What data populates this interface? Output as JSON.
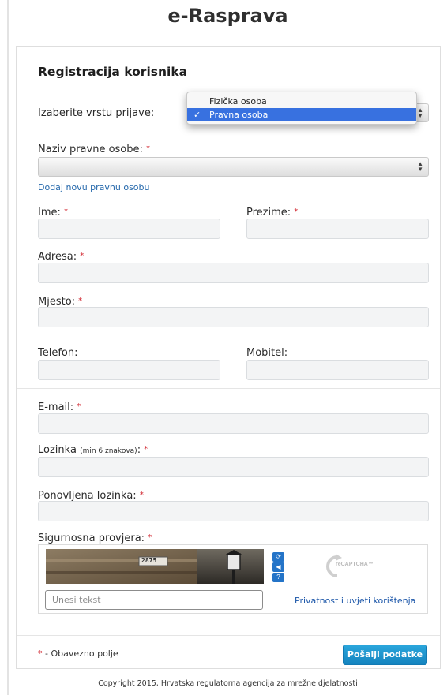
{
  "app": {
    "title": "e-Rasprava"
  },
  "form": {
    "section_title": "Registracija korisnika",
    "login_type": {
      "label": "Izaberite vrstu prijave:",
      "options": [
        "Fizička osoba",
        "Pravna osoba"
      ],
      "selected": "Pravna osoba",
      "check_mark": "✓"
    },
    "legal_entity": {
      "label": "Naziv pravne osobe:",
      "value": "",
      "add_link": "Dodaj novu pravnu osobu"
    },
    "first_name": {
      "label": "Ime:"
    },
    "last_name": {
      "label": "Prezime:"
    },
    "address": {
      "label": "Adresa:"
    },
    "city": {
      "label": "Mjesto:"
    },
    "phone": {
      "label": "Telefon:"
    },
    "mobile": {
      "label": "Mobitel:"
    },
    "email": {
      "label": "E-mail:"
    },
    "password": {
      "label": "Lozinka",
      "hint": "(min 6 znakova)",
      "colon": ":"
    },
    "password_repeat": {
      "label": "Ponovljena lozinka:"
    },
    "captcha": {
      "label": "Sigurnosna provjera:",
      "image_text": "2875",
      "placeholder": "Unesi tekst",
      "privacy_link": "Privatnost i uvjeti korištenja",
      "logo_text": "reCAPTCHA™"
    },
    "required_marker": "*",
    "required_note": " - Obavezno polje",
    "submit_label": "Pošalji podatke"
  },
  "footer": {
    "copyright": "Copyright 2015, Hrvatska regulatorna agencija za mrežne djelatnosti"
  },
  "colors": {
    "accent": "#1b8fcc",
    "link": "#2266aa",
    "required": "#d0202a",
    "selection": "#3871e0"
  }
}
